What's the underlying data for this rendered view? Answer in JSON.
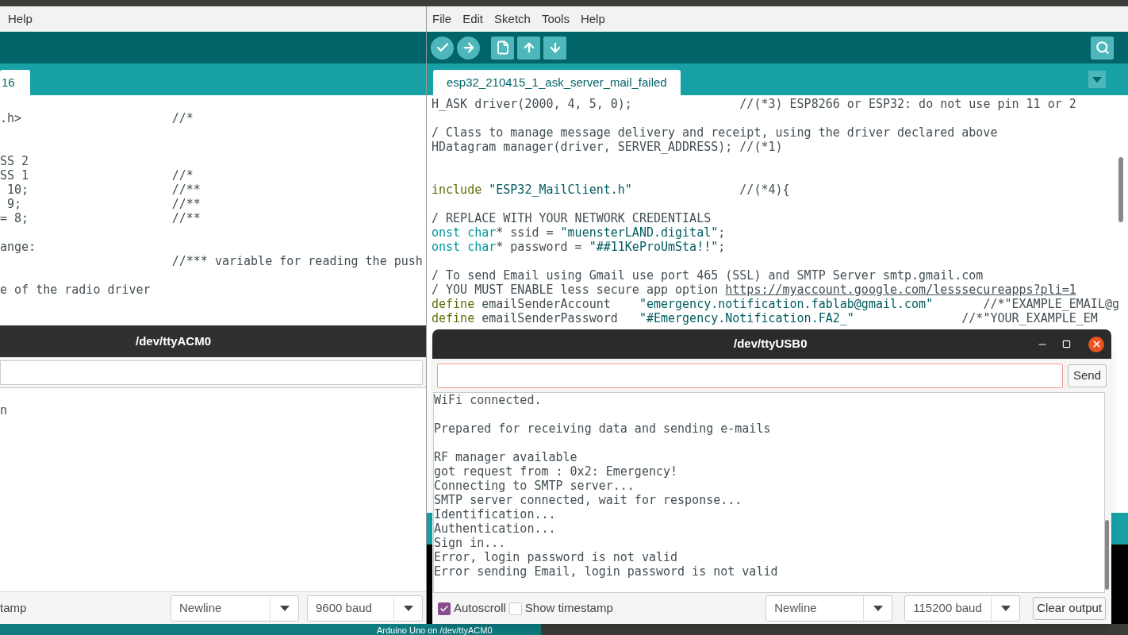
{
  "left_ide": {
    "menu": [
      {
        "label": "Help"
      }
    ],
    "tabs": [
      {
        "label": "16",
        "selected": true
      }
    ],
    "code_lines": [
      {
        "kind": "blank"
      },
      {
        "kind": "code",
        "segments": [
          {
            "text": ".h>                     //*",
            "kind": "plain"
          }
        ]
      },
      {
        "kind": "blank"
      },
      {
        "kind": "blank"
      },
      {
        "kind": "code",
        "segments": [
          {
            "text": "SS 2",
            "kind": "plain"
          }
        ]
      },
      {
        "kind": "code",
        "segments": [
          {
            "text": "SS 1                    //*",
            "kind": "plain"
          }
        ]
      },
      {
        "kind": "code",
        "segments": [
          {
            "text": " 10;                    //**",
            "kind": "plain"
          }
        ]
      },
      {
        "kind": "code",
        "segments": [
          {
            "text": " 9;                     //**",
            "kind": "plain"
          }
        ]
      },
      {
        "kind": "code",
        "segments": [
          {
            "text": "= 8;                    //**",
            "kind": "plain"
          }
        ]
      },
      {
        "kind": "blank"
      },
      {
        "kind": "code",
        "segments": [
          {
            "text": "ange:",
            "kind": "plain"
          }
        ]
      },
      {
        "kind": "code",
        "segments": [
          {
            "text": "                        //*** variable for reading the push",
            "kind": "plain"
          }
        ]
      },
      {
        "kind": "blank"
      },
      {
        "kind": "code",
        "segments": [
          {
            "text": "e of the radio driver",
            "kind": "plain"
          }
        ]
      }
    ]
  },
  "left_serial": {
    "title": "/dev/ttyACM0",
    "output": [
      "n"
    ],
    "timestamp_label": "tamp",
    "line_ending": "Newline",
    "baud": "9600 baud"
  },
  "right_ide": {
    "menu": [
      {
        "label": "File"
      },
      {
        "label": "Edit"
      },
      {
        "label": "Sketch"
      },
      {
        "label": "Tools"
      },
      {
        "label": "Help"
      }
    ],
    "tabs": [
      {
        "label": "esp32_210415_1_ask_server_mail_failed",
        "selected": true
      }
    ],
    "code_lines": [
      {
        "kind": "code",
        "segments": [
          {
            "text": "H_ASK driver(2000, 4, 5, 0);",
            "kind": "plain"
          },
          {
            "text": "               //(*3) ESP8266 or ESP32: do not use pin 11 or 2",
            "kind": "plain"
          }
        ]
      },
      {
        "kind": "blank"
      },
      {
        "kind": "code",
        "segments": [
          {
            "text": "/ Class to manage message delivery and receipt, using the driver declared above",
            "kind": "plain"
          }
        ]
      },
      {
        "kind": "code",
        "segments": [
          {
            "text": "HDatagram manager(driver, SERVER_ADDRESS); //(*1)",
            "kind": "plain"
          }
        ]
      },
      {
        "kind": "blank"
      },
      {
        "kind": "blank"
      },
      {
        "kind": "code",
        "segments": [
          {
            "text": "include",
            "kind": "keyword"
          },
          {
            "text": " \"ESP32_MailClient.h\"",
            "kind": "string"
          },
          {
            "text": "               //(*4){",
            "kind": "plain"
          }
        ]
      },
      {
        "kind": "blank"
      },
      {
        "kind": "code",
        "segments": [
          {
            "text": "/ REPLACE WITH YOUR NETWORK CREDENTIALS",
            "kind": "plain"
          }
        ]
      },
      {
        "kind": "code",
        "segments": [
          {
            "text": "onst char",
            "kind": "type"
          },
          {
            "text": "* ssid = ",
            "kind": "plain"
          },
          {
            "text": "\"muensterLAND.digital\"",
            "kind": "string"
          },
          {
            "text": ";",
            "kind": "plain"
          }
        ]
      },
      {
        "kind": "code",
        "segments": [
          {
            "text": "onst char",
            "kind": "type"
          },
          {
            "text": "* password = ",
            "kind": "plain"
          },
          {
            "text": "\"##11KeProUmSta!!\"",
            "kind": "string"
          },
          {
            "text": ";",
            "kind": "plain"
          }
        ]
      },
      {
        "kind": "blank"
      },
      {
        "kind": "code",
        "segments": [
          {
            "text": "/ To send Email using Gmail use port 465 (SSL) and SMTP Server smtp.gmail.com",
            "kind": "plain"
          }
        ]
      },
      {
        "kind": "code",
        "segments": [
          {
            "text": "/ YOU MUST ENABLE less secure app option ",
            "kind": "plain"
          },
          {
            "text": "https://myaccount.google.com/lesssecureapps?pli=1",
            "kind": "link"
          }
        ]
      },
      {
        "kind": "code",
        "segments": [
          {
            "text": "define",
            "kind": "keyword"
          },
          {
            "text": " emailSenderAccount    ",
            "kind": "plain"
          },
          {
            "text": "\"emergency.notification.fablab@gmail.com\"",
            "kind": "string"
          },
          {
            "text": "       //*\"EXAMPLE_EMAIL@g",
            "kind": "plain"
          }
        ]
      },
      {
        "kind": "code",
        "segments": [
          {
            "text": "define",
            "kind": "keyword"
          },
          {
            "text": " emailSenderPassword   ",
            "kind": "plain"
          },
          {
            "text": "\"#Emergency.Notification.FA2_\"",
            "kind": "string"
          },
          {
            "text": "               //*\"YOUR_EXAMPLE_EM",
            "kind": "plain"
          }
        ]
      }
    ]
  },
  "right_serial": {
    "title": "/dev/ttyUSB0",
    "send_label": "Send",
    "output": [
      {
        "kind": "line",
        "text": "WiFi connected."
      },
      {
        "kind": "blank"
      },
      {
        "kind": "line",
        "text": "Prepared for receiving data and sending e-mails"
      },
      {
        "kind": "blank"
      },
      {
        "kind": "line",
        "text": "RF manager available"
      },
      {
        "kind": "line",
        "text": "got request from : 0x2: Emergency!"
      },
      {
        "kind": "line",
        "text": "Connecting to SMTP server..."
      },
      {
        "kind": "line",
        "text": "SMTP server connected, wait for response..."
      },
      {
        "kind": "line",
        "text": "Identification..."
      },
      {
        "kind": "line",
        "text": "Authentication..."
      },
      {
        "kind": "line",
        "text": "Sign in..."
      },
      {
        "kind": "line",
        "text": "Error, login password is not valid"
      },
      {
        "kind": "line",
        "text": "Error sending Email, login password is not valid"
      }
    ],
    "autoscroll": {
      "label": "Autoscroll",
      "checked": true
    },
    "timestamp": {
      "label": "Show timestamp",
      "checked": false
    },
    "line_ending": "Newline",
    "baud": "115200 baud",
    "clear_label": "Clear output"
  },
  "status_bar": {
    "text": "Arduino Uno on /dev/ttyACM0"
  }
}
